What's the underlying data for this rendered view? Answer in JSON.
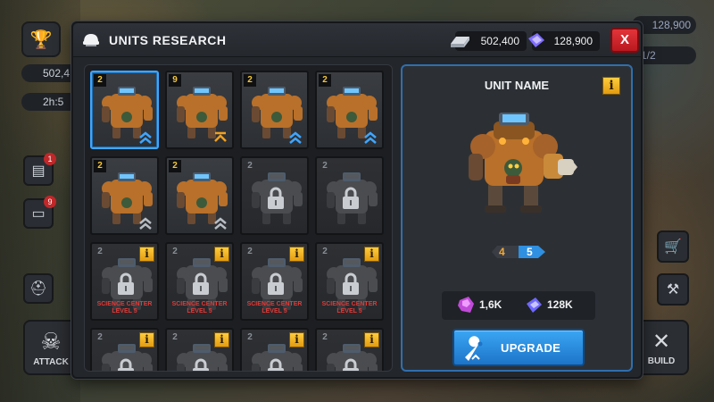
{
  "background": {
    "left_resource_1": "502,4",
    "left_resource_2": "2h:5",
    "right_resource_1": "128,900",
    "right_resource_2": "1/2",
    "attack_label": "ATTACK",
    "build_label": "BUILD",
    "notif_counts": [
      "1",
      "9"
    ]
  },
  "modal": {
    "title": "UNITS RESEARCH",
    "resources": {
      "metal": "502,400",
      "crystal": "128,900"
    },
    "close_label": "X"
  },
  "grid": {
    "cards": [
      {
        "level": "2",
        "locked": false,
        "selected": true,
        "chevron": "double-blue"
      },
      {
        "level": "9",
        "locked": false,
        "selected": false,
        "chevron": "single-orange"
      },
      {
        "level": "2",
        "locked": false,
        "selected": false,
        "chevron": "double-blue"
      },
      {
        "level": "2",
        "locked": false,
        "selected": false,
        "chevron": "double-blue"
      },
      {
        "level": "2",
        "locked": false,
        "selected": false,
        "chevron": "double-grey"
      },
      {
        "level": "2",
        "locked": false,
        "selected": false,
        "chevron": "double-grey"
      },
      {
        "level": "2",
        "locked": true,
        "info": false,
        "requirement": ""
      },
      {
        "level": "2",
        "locked": true,
        "info": false,
        "requirement": ""
      },
      {
        "level": "2",
        "locked": true,
        "info": true,
        "requirement": "SCIENCE CENTER LEVEL 5"
      },
      {
        "level": "2",
        "locked": true,
        "info": true,
        "requirement": "SCIENCE CENTER LEVEL 5"
      },
      {
        "level": "2",
        "locked": true,
        "info": true,
        "requirement": "SCIENCE CENTER LEVEL 5"
      },
      {
        "level": "2",
        "locked": true,
        "info": true,
        "requirement": "SCIENCE CENTER LEVEL 5"
      },
      {
        "level": "2",
        "locked": true,
        "info": true,
        "requirement": ""
      },
      {
        "level": "2",
        "locked": true,
        "info": true,
        "requirement": ""
      },
      {
        "level": "2",
        "locked": true,
        "info": true,
        "requirement": ""
      },
      {
        "level": "2",
        "locked": true,
        "info": true,
        "requirement": ""
      }
    ],
    "info_glyph": "i"
  },
  "detail": {
    "unit_name": "UNIT NAME",
    "info_glyph": "i",
    "current_level": "4",
    "next_level": "5",
    "cost_crystal": "1,6K",
    "cost_energy": "128K",
    "upgrade_label": "UPGRADE"
  },
  "colors": {
    "accent_blue": "#2f8fe0",
    "info_yellow": "#f2b322",
    "close_red": "#d42a30",
    "lock_text_red": "#e23a37"
  }
}
